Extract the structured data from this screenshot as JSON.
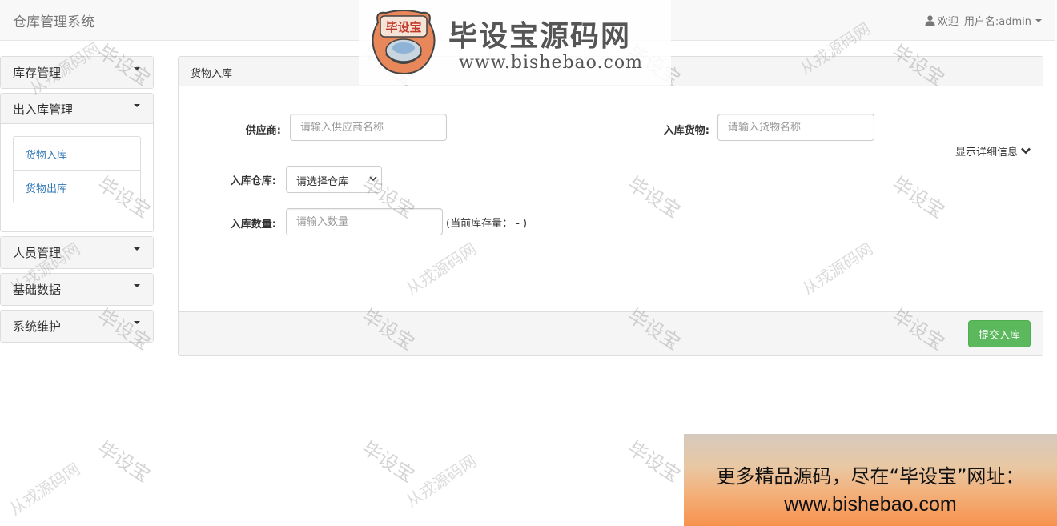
{
  "navbar": {
    "brand": "仓库管理系统",
    "welcome": "欢迎",
    "username": "用户名:admin"
  },
  "sidebar": {
    "groups": [
      {
        "label": "库存管理"
      },
      {
        "label": "出入库管理",
        "items": [
          {
            "label": "货物入库"
          },
          {
            "label": "货物出库"
          }
        ]
      },
      {
        "label": "人员管理"
      },
      {
        "label": "基础数据"
      },
      {
        "label": "系统维护"
      }
    ]
  },
  "panel": {
    "title": "货物入库",
    "supplier_label": "供应商:",
    "supplier_placeholder": "请输入供应商名称",
    "goods_label": "入库货物:",
    "goods_placeholder": "请输入货物名称",
    "detail_toggle": "显示详细信息",
    "warehouse_label": "入库仓库:",
    "warehouse_selected": "请选择仓库",
    "quantity_label": "入库数量:",
    "quantity_placeholder": "请输入数量",
    "stock_text": "(当前库存量： - )",
    "submit_label": "提交入库"
  },
  "watermark": {
    "short": "毕设宝",
    "long": "从戎源码网"
  },
  "logo": {
    "badge_text": "毕设宝",
    "name": "毕设宝源码网",
    "url": "www.bishebao.com"
  },
  "ad": {
    "line1": "更多精品源码，尽在“毕设宝”网址：",
    "line2": "www.bishebao.com"
  },
  "colors": {
    "success": "#5cb85c",
    "link": "#337ab7",
    "navbar_bg": "#f8f8f8"
  }
}
